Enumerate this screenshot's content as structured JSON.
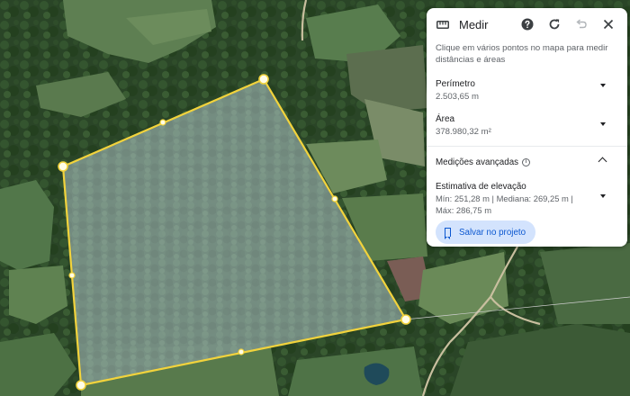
{
  "panel": {
    "title": "Medir",
    "hint": "Clique em vários pontos no mapa para medir distâncias e áreas",
    "perimeter": {
      "label": "Perímetro",
      "value": "2.503,65 m"
    },
    "area": {
      "label": "Área",
      "value": "378.980,32 m²"
    },
    "advanced": {
      "label": "Medições avançadas",
      "info_glyph": "i"
    },
    "elevation": {
      "label": "Estimativa de elevação",
      "value": "Mín: 251,28 m | Mediana: 269,25 m | Máx: 286,75 m"
    },
    "save_label": "Salvar no projeto",
    "icons": [
      "ruler-icon",
      "help-icon",
      "refresh-icon",
      "undo-icon",
      "close-icon"
    ]
  },
  "colors": {
    "polygon_stroke": "#f2d33c",
    "polygon_fill": "rgba(200,215,235,0.42)",
    "accent": "#0b57d0",
    "button_bg": "#d3e3fd"
  }
}
